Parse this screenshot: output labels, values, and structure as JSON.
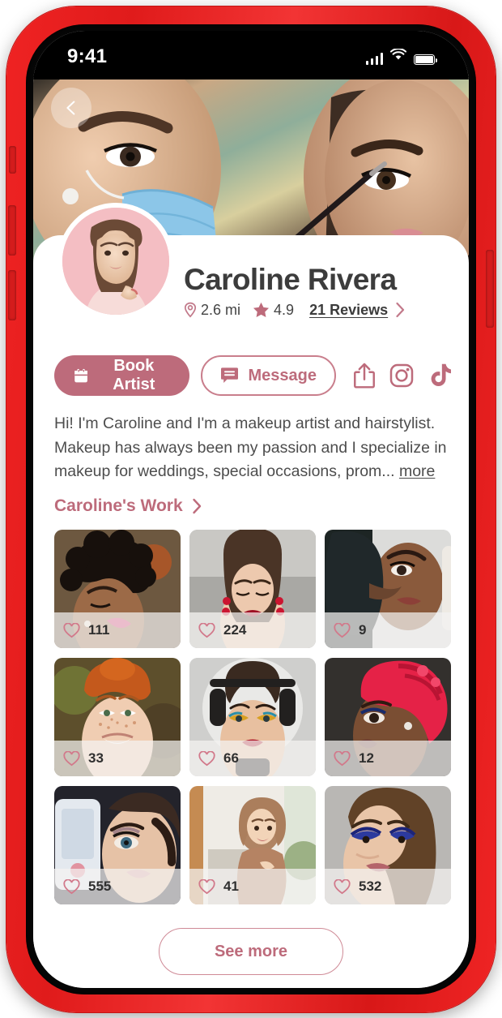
{
  "status_bar": {
    "time": "9:41",
    "signal_icon": "cellular-signal-icon",
    "wifi_icon": "wifi-icon",
    "battery_icon": "battery-full-icon"
  },
  "header": {
    "back_icon": "chevron-left-icon",
    "hero_image_alt": "makeup-artist-applying-eyeliner"
  },
  "profile": {
    "avatar_alt": "caroline-rivera-avatar",
    "name": "Caroline Rivera",
    "distance": "2.6 mi",
    "distance_icon": "location-pin-icon",
    "rating": "4.9",
    "rating_icon": "star-icon",
    "reviews_label": "21 Reviews",
    "reviews_chevron": "chevron-right-icon"
  },
  "actions": {
    "book_label": "Book Artist",
    "book_icon": "calendar-icon",
    "message_label": "Message",
    "message_icon": "chat-bubble-icon",
    "share_icon": "share-icon",
    "instagram_icon": "instagram-icon",
    "tiktok_icon": "tiktok-icon"
  },
  "bio": {
    "text": "Hi! I'm Caroline and I'm a makeup artist and hairstylist. Makeup has always been my passion and I specialize in makeup for weddings, special occasions, prom...",
    "more_label": "more"
  },
  "work_section": {
    "title": "Caroline's Work",
    "chevron_icon": "chevron-right-icon",
    "items": [
      {
        "alt": "curly-hair-glam-makeup",
        "likes": "111"
      },
      {
        "alt": "red-lip-bold-earrings",
        "likes": "224"
      },
      {
        "alt": "smoky-eye-long-hair",
        "likes": "9"
      },
      {
        "alt": "freckled-redhead-natural",
        "likes": "33"
      },
      {
        "alt": "colorful-eyeshadow-headphones",
        "likes": "66"
      },
      {
        "alt": "red-braided-updo-profile",
        "likes": "12"
      },
      {
        "alt": "blue-eye-selfie",
        "likes": "555"
      },
      {
        "alt": "hijab-portrait-smiling",
        "likes": "41"
      },
      {
        "alt": "navy-blue-eyeshadow",
        "likes": "532"
      }
    ],
    "like_icon": "heart-icon",
    "see_more_label": "See more"
  },
  "colors": {
    "accent_rose": "#bd6b7b",
    "accent_rose_light": "#cf8a96",
    "text_dark": "#3c3c3c",
    "phone_case_red": "#e01b1b"
  }
}
